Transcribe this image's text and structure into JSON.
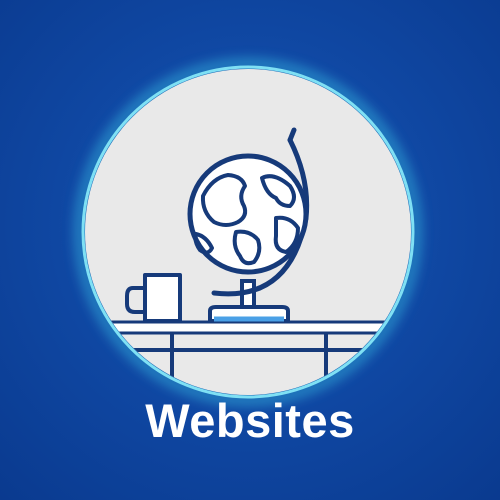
{
  "tile": {
    "label": "Websites",
    "icon_name": "globe-on-desk-icon"
  },
  "colors": {
    "background": "#1049a5",
    "circle_fill": "#e9e9e9",
    "circle_glow": "#3cc8e8",
    "line_art": "#163a7a",
    "label_text": "#ffffff"
  }
}
